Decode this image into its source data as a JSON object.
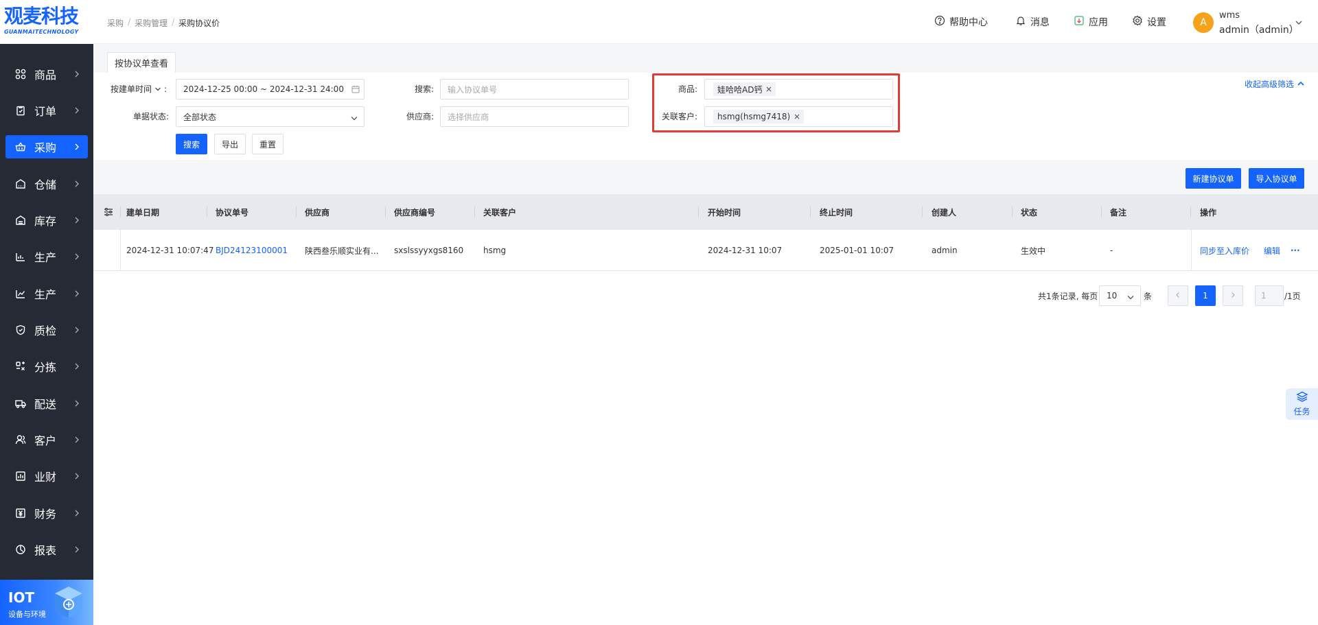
{
  "brand": {
    "logo_text": "观麦科技",
    "logo_sub": "GUANMAITECHNOLOGY",
    "color": "#1463ff"
  },
  "sidebar": {
    "items": [
      {
        "label": "商品",
        "icon": "grid-icon"
      },
      {
        "label": "订单",
        "icon": "order-icon"
      },
      {
        "label": "采购",
        "icon": "basket-icon",
        "active": true
      },
      {
        "label": "仓储",
        "icon": "warehouse-icon"
      },
      {
        "label": "库存",
        "icon": "stock-icon"
      },
      {
        "label": "生产",
        "icon": "factory-icon"
      },
      {
        "label": "生产",
        "icon": "chart-icon"
      },
      {
        "label": "质检",
        "icon": "shield-icon"
      },
      {
        "label": "分拣",
        "icon": "sort-icon"
      },
      {
        "label": "配送",
        "icon": "truck-icon"
      },
      {
        "label": "客户",
        "icon": "user-icon"
      },
      {
        "label": "业财",
        "icon": "finance-chart-icon"
      },
      {
        "label": "财务",
        "icon": "money-icon"
      },
      {
        "label": "报表",
        "icon": "pie-icon"
      }
    ],
    "iot": {
      "title": "IOT",
      "subtitle": "设备与环境"
    }
  },
  "header": {
    "breadcrumb": [
      "采购",
      "采购管理",
      "采购协议价"
    ],
    "help": "帮助中心",
    "messages": "消息",
    "apps": "应用",
    "settings": "设置",
    "user": {
      "avatar": "A",
      "name": "wms",
      "role": "admin（admin）"
    }
  },
  "tabs": {
    "active": "按协议单查看"
  },
  "filters": {
    "time_type": "按建单时间",
    "date_range": "2024-12-25 00:00 ~ 2024-12-31 24:00",
    "search_label": "搜索:",
    "search_placeholder": "输入协议单号",
    "product_label": "商品:",
    "product_tag": "娃哈哈AD钙",
    "status_label": "单据状态:",
    "status_value": "全部状态",
    "supplier_label": "供应商:",
    "supplier_placeholder": "选择供应商",
    "customer_label": "关联客户:",
    "customer_tag": "hsmg(hsmg7418)",
    "collapse": "收起高级筛选",
    "btn_search": "搜索",
    "btn_export": "导出",
    "btn_reset": "重置"
  },
  "actions": {
    "new": "新建协议单",
    "import": "导入协议单"
  },
  "table": {
    "columns": [
      "建单日期",
      "协议单号",
      "供应商",
      "供应商编号",
      "关联客户",
      "开始时间",
      "终止时间",
      "创建人",
      "状态",
      "备注",
      "操作"
    ],
    "rows": [
      {
        "created": "2024-12-31 10:07:47",
        "no": "BJD24123100001",
        "supplier": "陕西叁乐顺实业有...",
        "supplier_code": "sxslssyyxgs8160",
        "customer": "hsmg",
        "start": "2024-12-31 10:07",
        "end": "2025-01-01 10:07",
        "creator": "admin",
        "status": "生效中",
        "remark": "-",
        "op_sync": "同步至入库价",
        "op_edit": "编辑",
        "op_more": "···"
      }
    ]
  },
  "pagination": {
    "summary": "共1条记录, 每页",
    "page_size": "10",
    "unit": "条",
    "current": "1",
    "jump_value": "1",
    "total_pages": "/1页"
  },
  "float": {
    "task": "任务"
  }
}
